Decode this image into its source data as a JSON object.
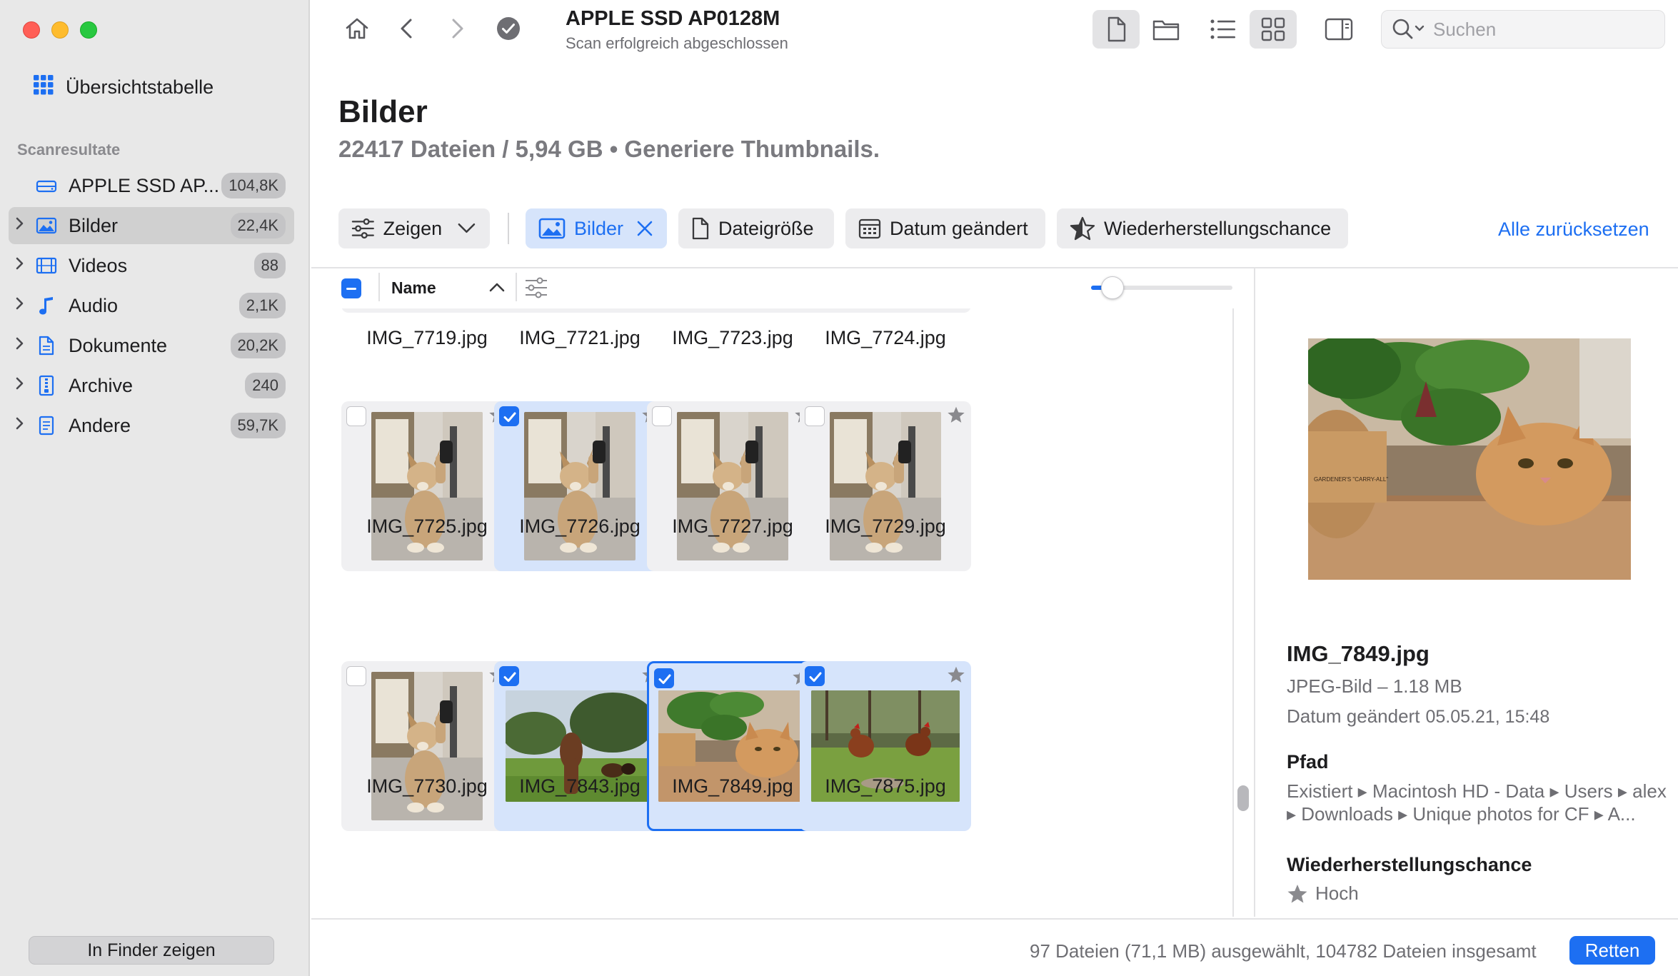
{
  "sidebar": {
    "overview_label": "Übersichtstabelle",
    "section_label": "Scanresultate",
    "items": [
      {
        "label": "APPLE SSD AP...",
        "count": "104,8K",
        "icon": "drive-icon",
        "chevron": false,
        "selected": false
      },
      {
        "label": "Bilder",
        "count": "22,4K",
        "icon": "image-icon",
        "chevron": true,
        "selected": true
      },
      {
        "label": "Videos",
        "count": "88",
        "icon": "film-icon",
        "chevron": true,
        "selected": false
      },
      {
        "label": "Audio",
        "count": "2,1K",
        "icon": "music-note-icon",
        "chevron": true,
        "selected": false
      },
      {
        "label": "Dokumente",
        "count": "20,2K",
        "icon": "document-icon",
        "chevron": true,
        "selected": false
      },
      {
        "label": "Archive",
        "count": "240",
        "icon": "archive-icon",
        "chevron": true,
        "selected": false
      },
      {
        "label": "Andere",
        "count": "59,7K",
        "icon": "file-icon",
        "chevron": true,
        "selected": false
      }
    ],
    "finder_button": "In Finder zeigen"
  },
  "toolbar": {
    "title": "APPLE SSD AP0128M",
    "subtitle": "Scan erfolgreich abgeschlossen",
    "search_placeholder": "Suchen"
  },
  "header": {
    "title": "Bilder",
    "subtitle": "22417 Dateien / 5,94 GB • Generiere Thumbnails."
  },
  "filters": {
    "show_label": "Zeigen",
    "images_label": "Bilder",
    "size_label": "Dateigröße",
    "date_label": "Datum geändert",
    "chance_label": "Wiederherstellungschance",
    "reset_label": "Alle zurücksetzen"
  },
  "columns": {
    "name_label": "Name",
    "zoom_level": 0.15
  },
  "grid": {
    "top_row_names": [
      "IMG_7719.jpg",
      "IMG_7721.jpg",
      "IMG_7723.jpg",
      "IMG_7724.jpg"
    ],
    "files": [
      {
        "name": "IMG_7725.jpg",
        "checked": false,
        "focused": false,
        "thumb": "dog"
      },
      {
        "name": "IMG_7726.jpg",
        "checked": true,
        "focused": false,
        "thumb": "dog"
      },
      {
        "name": "IMG_7727.jpg",
        "checked": false,
        "focused": false,
        "thumb": "dog"
      },
      {
        "name": "IMG_7729.jpg",
        "checked": false,
        "focused": false,
        "thumb": "dog"
      },
      {
        "name": "IMG_7730.jpg",
        "checked": false,
        "focused": false,
        "thumb": "dog2"
      },
      {
        "name": "IMG_7843.jpg",
        "checked": true,
        "focused": false,
        "thumb": "horse"
      },
      {
        "name": "IMG_7849.jpg",
        "checked": true,
        "focused": true,
        "thumb": "cat"
      },
      {
        "name": "IMG_7875.jpg",
        "checked": true,
        "focused": false,
        "thumb": "chicken"
      }
    ]
  },
  "details": {
    "filename": "IMG_7849.jpg",
    "type": "JPEG-Bild – 1.18 MB",
    "date_label": "Datum geändert",
    "date_value": "05.05.21, 15:48",
    "path_heading": "Pfad",
    "path_text": "Existiert ▸ Macintosh HD - Data ▸ Users ▸ alex ▸ Downloads ▸ Unique photos for CF ▸ A...",
    "chance_heading": "Wiederherstellungschance",
    "chance_value": "Hoch"
  },
  "footer": {
    "status": "97 Dateien (71,1 MB) ausgewählt, 104782 Dateien insgesamt",
    "recover_button": "Retten"
  },
  "colors": {
    "accent": "#1d6ff2",
    "sidebar_bg": "#e8e8e8",
    "selection_bg": "#d6e4fb"
  }
}
